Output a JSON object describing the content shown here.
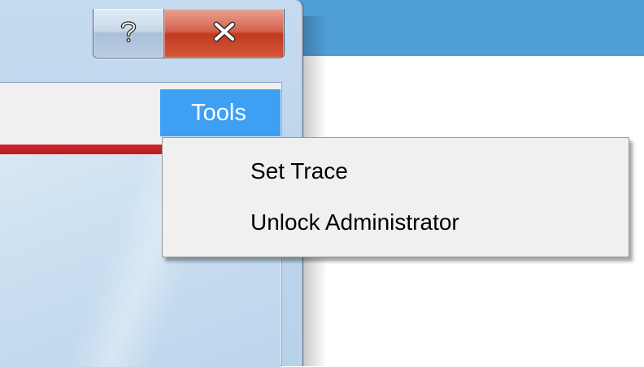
{
  "window": {
    "caption_buttons": {
      "help_icon": "question-mark-icon",
      "close_icon": "close-x-icon"
    }
  },
  "menubar": {
    "tools_label": "Tools"
  },
  "dropdown": {
    "items": [
      {
        "label": "Set Trace"
      },
      {
        "label": "Unlock Administrator"
      }
    ]
  },
  "colors": {
    "menu_highlight": "#3da0f2",
    "close_button": "#c23a1f",
    "background_titlebar": "#4f9ed6",
    "accent_strip": "#d0252b"
  }
}
